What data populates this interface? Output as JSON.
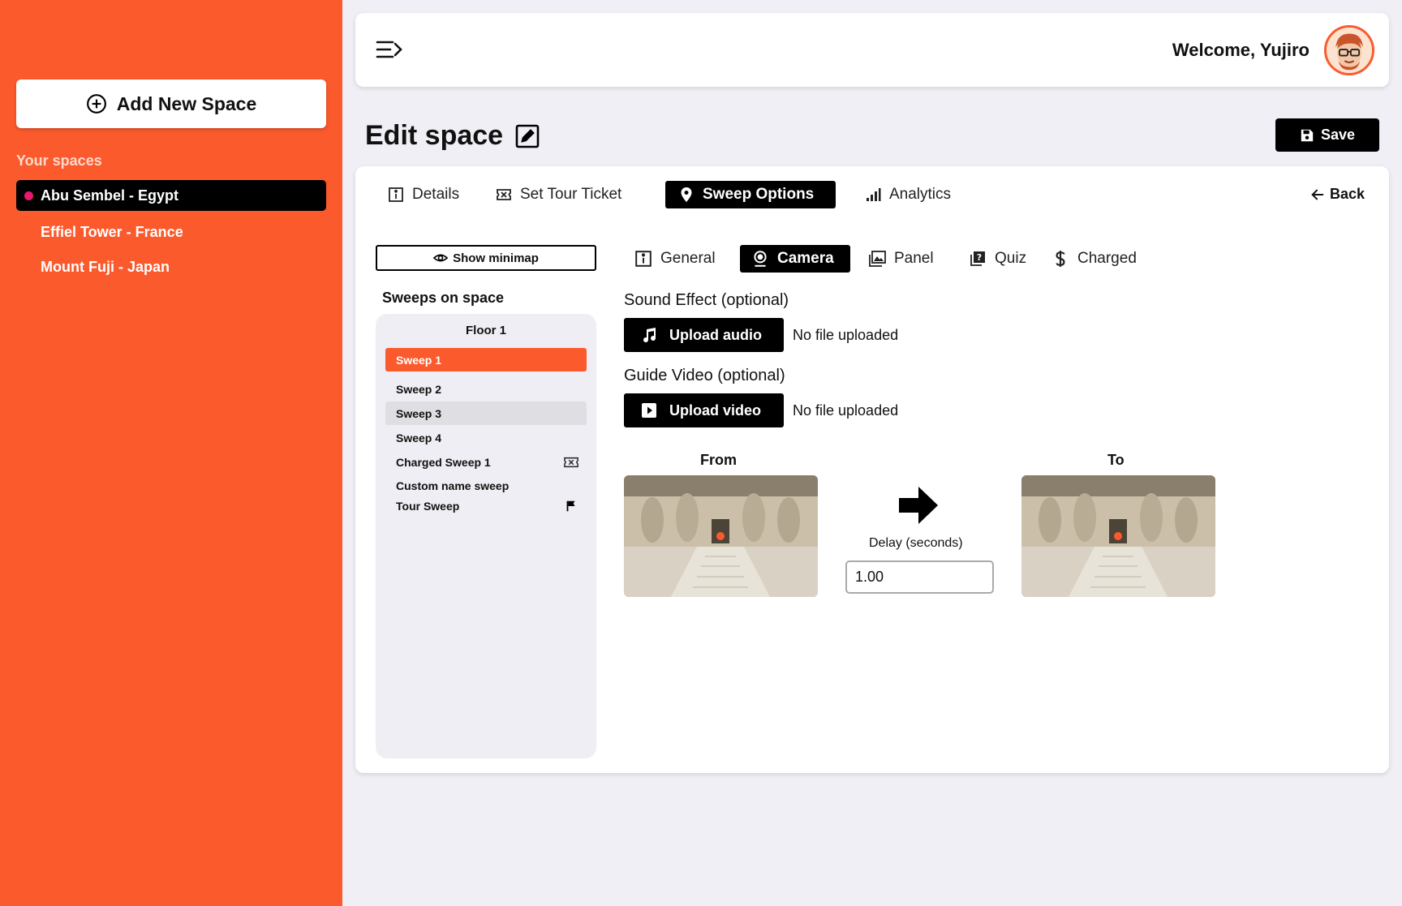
{
  "sidebar": {
    "add_button_label": "Add New Space",
    "spaces_heading": "Your spaces",
    "spaces": [
      {
        "label": "Abu Sembel - Egypt",
        "active": true
      },
      {
        "label": "Effiel Tower - France",
        "active": false
      },
      {
        "label": "Mount Fuji - Japan",
        "active": false
      }
    ]
  },
  "header": {
    "welcome_text": "Welcome, Yujiro",
    "avatar_icon": "user-avatar"
  },
  "page": {
    "title": "Edit space",
    "save_label": "Save"
  },
  "tabs": [
    {
      "label": "Details",
      "icon": "info-icon",
      "active": false
    },
    {
      "label": "Set Tour Ticket",
      "icon": "ticket-icon",
      "active": false
    },
    {
      "label": "Sweep Options",
      "icon": "map-pin-icon",
      "active": true
    },
    {
      "label": "Analytics",
      "icon": "bar-chart-icon",
      "active": false
    }
  ],
  "back_label": "Back",
  "sweeps": {
    "minimap_label": "Show minimap",
    "heading": "Sweeps on space",
    "floor": "Floor 1",
    "items": [
      {
        "label": "Sweep 1",
        "state": "active"
      },
      {
        "label": "Sweep 2",
        "state": ""
      },
      {
        "label": "Sweep 3",
        "state": "hover"
      },
      {
        "label": "Sweep 4",
        "state": ""
      },
      {
        "label": "Charged Sweep 1",
        "state": "",
        "icon": "ticket-icon"
      },
      {
        "label": "Custom name sweep",
        "state": ""
      },
      {
        "label": "Tour Sweep",
        "state": "",
        "icon": "flag-icon"
      }
    ]
  },
  "subtabs": [
    {
      "label": "General",
      "icon": "info-icon",
      "active": false
    },
    {
      "label": "Camera",
      "icon": "webcam-icon",
      "active": true
    },
    {
      "label": "Panel",
      "icon": "images-icon",
      "active": false
    },
    {
      "label": "Quiz",
      "icon": "quiz-icon",
      "active": false
    },
    {
      "label": "Charged",
      "icon": "dollar-icon",
      "active": false
    }
  ],
  "camera": {
    "sound_label": "Sound Effect (optional)",
    "upload_audio_label": "Upload audio",
    "audio_status": "No file uploaded",
    "video_label": "Guide Video (optional)",
    "upload_video_label": "Upload video",
    "video_status": "No file uploaded",
    "from_label": "From",
    "to_label": "To",
    "delay_label": "Delay (seconds)",
    "delay_value": "1.00"
  },
  "colors": {
    "accent": "#fb5a2d",
    "active_dot": "#e6186f"
  }
}
